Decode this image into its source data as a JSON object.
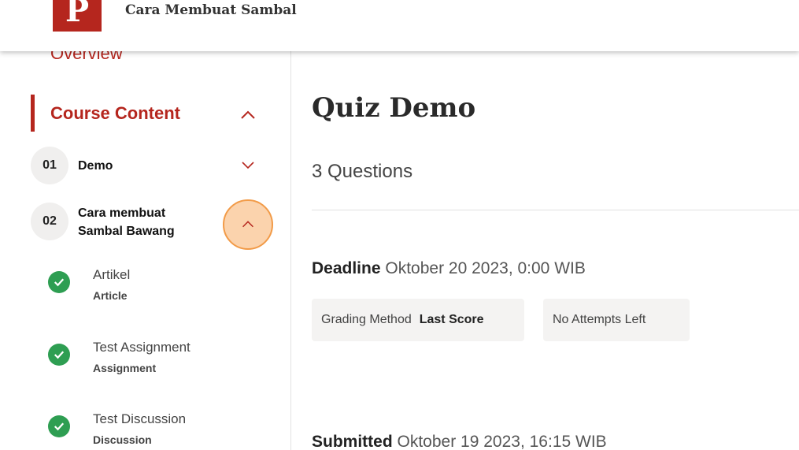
{
  "header": {
    "logo_letter": "P",
    "app_title": "Cara Membuat Sambal"
  },
  "sidebar": {
    "overview_label": "Overview",
    "section_title": "Course Content",
    "modules": [
      {
        "number": "01",
        "title": "Demo"
      },
      {
        "number": "02",
        "title_line1": "Cara membuat",
        "title_line2": "Sambal Bawang"
      }
    ],
    "lessons": [
      {
        "title": "Artikel",
        "type": "Article"
      },
      {
        "title": "Test Assignment",
        "type": "Assignment"
      },
      {
        "title": "Test Discussion",
        "type": "Discussion"
      }
    ]
  },
  "main": {
    "title": "Quiz Demo",
    "questions": "3 Questions",
    "deadline_label": "Deadline",
    "deadline_value": "Oktober 20 2023, 0:00 WIB",
    "grading_label": "Grading Method",
    "grading_value": "Last Score",
    "attempts": "No Attempts Left",
    "submitted_label": "Submitted",
    "submitted_value": "Oktober 19 2023, 16:15 WIB"
  },
  "colors": {
    "brand": "#b5261e",
    "check": "#2e9e52",
    "highlight": "#f29b48"
  }
}
